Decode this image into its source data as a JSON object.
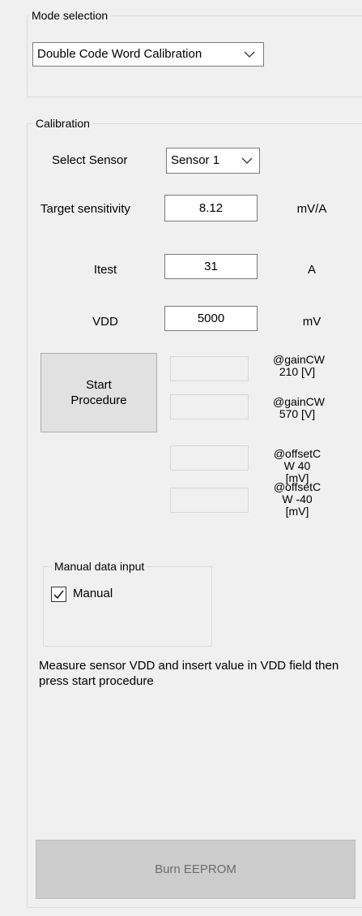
{
  "mode_selection": {
    "group_title": "Mode selection",
    "selected_mode": "Double Code Word Calibration"
  },
  "calibration": {
    "group_title": "Calibration",
    "select_sensor_label": "Select Sensor",
    "selected_sensor": "Sensor 1",
    "target_sensitivity": {
      "label": "Target sensitivity",
      "value": "8.12",
      "unit": "mV/A"
    },
    "itest": {
      "label": "Itest",
      "value": "31",
      "unit": "A"
    },
    "vdd": {
      "label": "VDD",
      "value": "5000",
      "unit": "mV"
    },
    "start_button_label": "Start Procedure",
    "results": [
      {
        "label": "@gainCW 210 [V]",
        "value": ""
      },
      {
        "label": "@gainCW 570 [V]",
        "value": ""
      },
      {
        "label": "@offsetC W 40 [mV]",
        "value": ""
      },
      {
        "label": "@offsetC W -40 [mV]",
        "value": ""
      }
    ],
    "manual_data_input": {
      "group_title": "Manual data input",
      "checkbox_label": "Manual",
      "checked": true
    },
    "instructions": "Measure sensor VDD and insert value in VDD field then press start procedure",
    "burn_button_label": "Burn EEPROM"
  },
  "colors": {
    "window_bg": "#f0f0f0",
    "disabled_text": "#6d6d6d"
  },
  "icons": {
    "dropdown": "chevron-down-icon",
    "check": "checkmark-icon"
  }
}
